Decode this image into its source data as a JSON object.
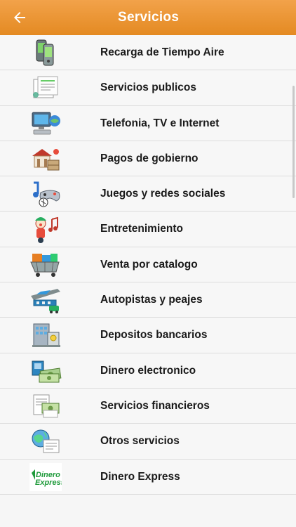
{
  "header": {
    "title": "Servicios",
    "back_icon": "arrow-left-icon",
    "color": "#e8922a"
  },
  "services": [
    {
      "label": "Recarga de Tiempo Aire",
      "icon": "mobile-phones-icon"
    },
    {
      "label": "Servicios publicos",
      "icon": "utility-bill-icon"
    },
    {
      "label": "Telefonia, TV e Internet",
      "icon": "computer-globe-icon"
    },
    {
      "label": "Pagos de gobierno",
      "icon": "government-building-icon"
    },
    {
      "label": "Juegos y redes sociales",
      "icon": "gamepad-music-icon"
    },
    {
      "label": "Entretenimiento",
      "icon": "clown-music-icon"
    },
    {
      "label": "Venta por catalogo",
      "icon": "shopping-cart-icon"
    },
    {
      "label": "Autopistas y peajes",
      "icon": "highway-toll-icon"
    },
    {
      "label": "Depositos bancarios",
      "icon": "bank-building-icon"
    },
    {
      "label": "Dinero electronico",
      "icon": "money-card-icon"
    },
    {
      "label": "Servicios financieros",
      "icon": "finance-documents-icon"
    },
    {
      "label": "Otros servicios",
      "icon": "globe-documents-icon"
    },
    {
      "label": "Dinero Express",
      "icon": "dinero-express-logo",
      "logo_text": [
        "Dinero",
        "Express"
      ]
    }
  ]
}
